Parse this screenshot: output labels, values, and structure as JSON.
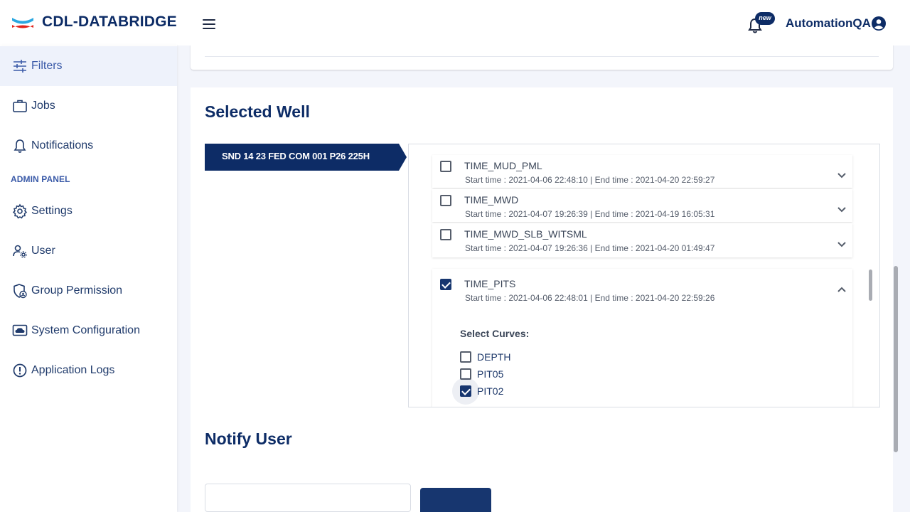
{
  "header": {
    "brand": "CDL-DATABRIDGE",
    "notification_badge": "new",
    "username": "AutomationQA"
  },
  "sidebar": {
    "items": [
      {
        "label": "Filters",
        "icon": "sliders-icon"
      },
      {
        "label": "Jobs",
        "icon": "briefcase-icon"
      },
      {
        "label": "Notifications",
        "icon": "bell-icon"
      }
    ],
    "admin_label": "ADMIN PANEL",
    "admin_items": [
      {
        "label": "Settings",
        "icon": "gear-icon"
      },
      {
        "label": "User",
        "icon": "user-gear-icon"
      },
      {
        "label": "Group Permission",
        "icon": "group-permission-icon"
      },
      {
        "label": "System Configuration",
        "icon": "cloud-monitor-icon"
      },
      {
        "label": "Application Logs",
        "icon": "alert-circle-icon"
      }
    ]
  },
  "main": {
    "selected_well_title": "Selected Well",
    "well_name": "SND 14 23 FED COM 001 P26 225H",
    "logs": [
      {
        "name": "TIME_MUD_PML",
        "start": "Start time : 2021-04-06 22:48:10",
        "end": "| End time : 2021-04-20 22:59:27",
        "checked": false,
        "expanded": false
      },
      {
        "name": "TIME_MWD",
        "start": "Start time : 2021-04-07 19:26:39",
        "end": "| End time : 2021-04-19 16:05:31",
        "checked": false,
        "expanded": false
      },
      {
        "name": "TIME_MWD_SLB_WITSML",
        "start": "Start time : 2021-04-07 19:26:36",
        "end": "| End time : 2021-04-20 01:49:47",
        "checked": false,
        "expanded": false
      },
      {
        "name": "TIME_PITS",
        "start": "Start time : 2021-04-06 22:48:01",
        "end": "| End time : 2021-04-20 22:59:26",
        "checked": true,
        "expanded": true
      }
    ],
    "select_curves_label": "Select Curves:",
    "curves": [
      {
        "name": "DEPTH",
        "checked": false
      },
      {
        "name": "PIT05",
        "checked": false
      },
      {
        "name": "PIT02",
        "checked": true
      }
    ],
    "notify_user_title": "Notify User"
  },
  "colors": {
    "brand_navy": "#0d2c66",
    "accent": "#17366f",
    "logo_blue": "#2aa7e0",
    "logo_red": "#e2231a"
  }
}
